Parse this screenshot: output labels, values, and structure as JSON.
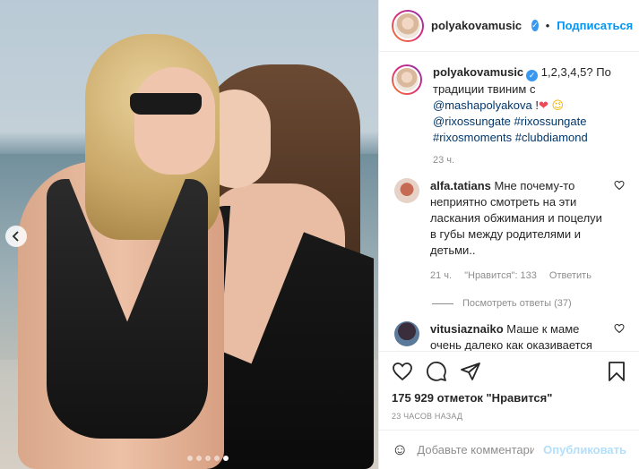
{
  "header": {
    "username": "polyakovamusic",
    "separator": "•",
    "follow_label": "Подписаться",
    "more_label": "•••"
  },
  "caption": {
    "username": "polyakovamusic",
    "text_before": "1,2,3,4,5? По традиции твиним с",
    "mention": "@mashapolyakova",
    "text_after": " !",
    "heart_emoji": "❤",
    "smile_emoji": "😉",
    "hashtags": [
      "@rixossungate",
      "#rixossungate",
      "#rixosmoments",
      "#clubdiamond"
    ],
    "time": "23 ч."
  },
  "comments": [
    {
      "username": "alfa.tatians",
      "text": "Мне почему-то неприятно смотреть на эти ласкания обжимания и поцелуи в губы между родителями и детьми..",
      "time": "21 ч.",
      "likes": "\"Нравится\": 133",
      "reply_label": "Ответить",
      "view_replies": "Посмотреть ответы (37)"
    },
    {
      "username": "vitusiaznaiko",
      "text": "Маше к маме очень далеко как оказивается"
    }
  ],
  "actions": {
    "likes_text": "175 929 отметок \"Нравится\"",
    "posted_time": "23 часов назад"
  },
  "add_comment": {
    "placeholder": "Добавьте комментарий...",
    "publish_label": "Опубликовать",
    "emoji_icon": "☺"
  },
  "carousel": {
    "dot_count": 5,
    "active_index": 4
  },
  "colors": {
    "accent": "#0095f6",
    "verified": "#3897f0",
    "publish_disabled": "#b2dffc",
    "heart": "#ed4956"
  }
}
